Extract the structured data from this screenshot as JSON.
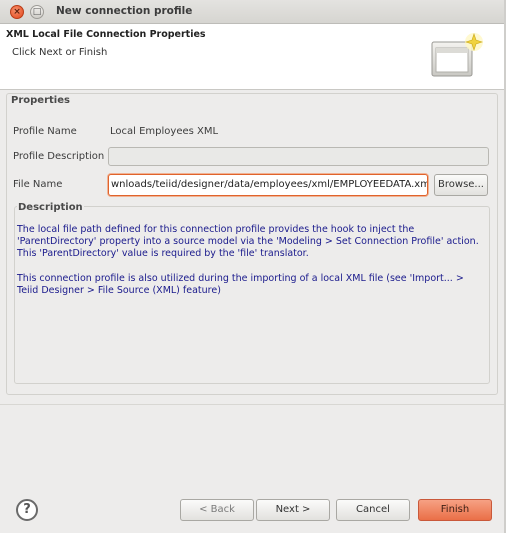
{
  "window": {
    "title": "New connection profile"
  },
  "banner": {
    "title": "XML Local File Connection Properties",
    "message": "Click Next or Finish"
  },
  "properties": {
    "group_title": "Properties",
    "profile_name_label": "Profile Name",
    "profile_name_value": "Local Employees XML",
    "profile_description_label": "Profile Description",
    "profile_description_value": "",
    "file_name_label": "File Name",
    "file_name_value": "wnloads/teiid/designer/data/employees/xml/EMPLOYEEDATA.xml",
    "browse_label": "Browse..."
  },
  "description": {
    "title": "Description",
    "paragraph1": "The local file path defined for this connection profile provides the hook to inject the 'ParentDirectory' property into a source model via the 'Modeling > Set Connection Profile' action. This 'ParentDirectory' value is required by the 'file' translator.",
    "paragraph2": "This connection profile is also utilized during the importing of a local XML file (see 'Import... > Teiid Designer > File Source (XML) feature)"
  },
  "buttons": {
    "help_icon": "question-mark-icon",
    "back": "< Back",
    "next": "Next >",
    "cancel": "Cancel",
    "finish": "Finish"
  },
  "colors": {
    "accent": "#ea6f47",
    "description_text": "#1a1a8c",
    "focus_border": "#e0632c"
  }
}
